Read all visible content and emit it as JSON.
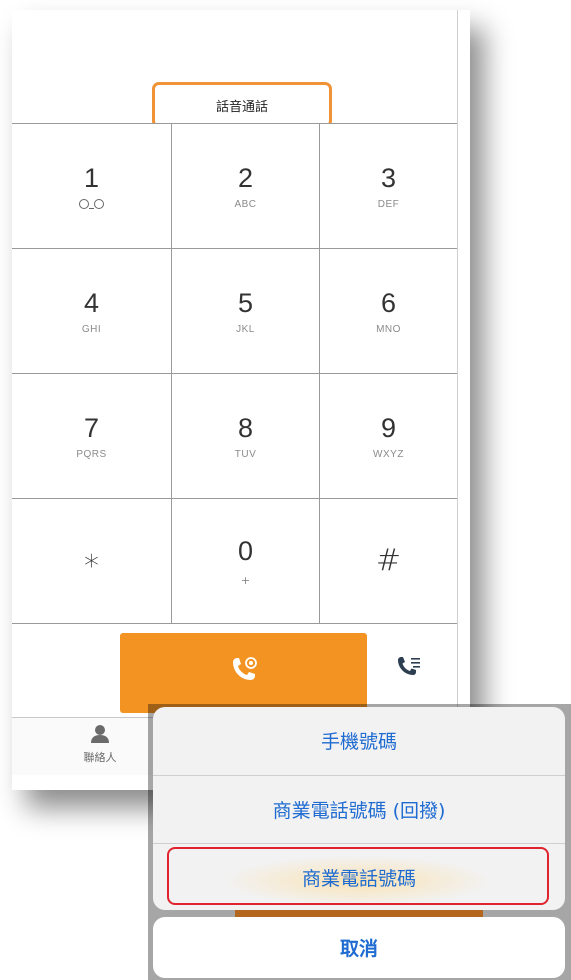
{
  "dialer": {
    "mode_label": "話音通話",
    "keys": [
      {
        "digit": "1",
        "letters": "",
        "icon": "voicemail-icon"
      },
      {
        "digit": "2",
        "letters": "ABC"
      },
      {
        "digit": "3",
        "letters": "DEF"
      },
      {
        "digit": "4",
        "letters": "GHI"
      },
      {
        "digit": "5",
        "letters": "JKL"
      },
      {
        "digit": "6",
        "letters": "MNO"
      },
      {
        "digit": "7",
        "letters": "PQRS"
      },
      {
        "digit": "8",
        "letters": "TUV"
      },
      {
        "digit": "9",
        "letters": "WXYZ"
      },
      {
        "digit": "∗",
        "letters": ""
      },
      {
        "digit": "0",
        "letters": "+"
      },
      {
        "digit": "#",
        "letters": ""
      }
    ],
    "call_icon": "phone-call-icon",
    "history_icon": "call-history-icon",
    "tab_contacts_label": "聯絡人",
    "accent_color": "#f39322"
  },
  "action_sheet": {
    "options": [
      {
        "label": "手機號碼"
      },
      {
        "label": "商業電話號碼 (回撥)"
      },
      {
        "label": "商業電話號碼"
      }
    ],
    "cancel_label": "取消",
    "highlighted_option": "商業電話號碼",
    "text_color": "#1e6bd1",
    "highlight_color": "#e0242f"
  }
}
